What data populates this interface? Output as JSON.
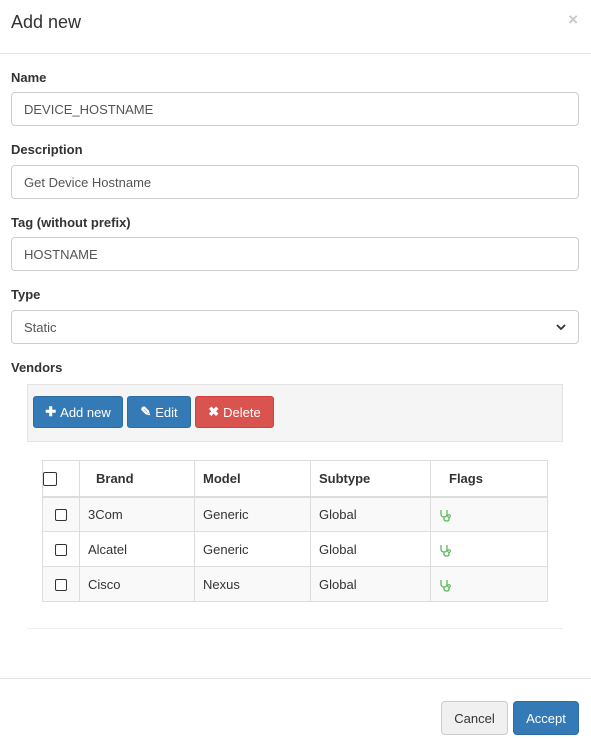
{
  "modal": {
    "title": "Add new",
    "close_glyph": "×"
  },
  "form": {
    "name_label": "Name",
    "name_value": "DEVICE_HOSTNAME",
    "description_label": "Description",
    "description_value": "Get Device Hostname",
    "tag_label": "Tag (without prefix)",
    "tag_value": "HOSTNAME",
    "type_label": "Type",
    "type_selected": "Static",
    "vendors_label": "Vendors"
  },
  "toolbar": {
    "add_label": "Add new",
    "add_icon": "plus-icon",
    "edit_label": "Edit",
    "edit_icon": "pencil-icon",
    "delete_label": "Delete",
    "delete_icon": "x-icon"
  },
  "table": {
    "columns": [
      "Brand",
      "Model",
      "Subtype",
      "Flags"
    ],
    "rows": [
      {
        "brand": "3Com",
        "model": "Generic",
        "subtype": "Global",
        "flag_icon": "stethoscope-icon"
      },
      {
        "brand": "Alcatel",
        "model": "Generic",
        "subtype": "Global",
        "flag_icon": "stethoscope-icon"
      },
      {
        "brand": "Cisco",
        "model": "Nexus",
        "subtype": "Global",
        "flag_icon": "stethoscope-icon"
      }
    ]
  },
  "footer": {
    "cancel_label": "Cancel",
    "accept_label": "Accept"
  },
  "colors": {
    "primary": "#337ab7",
    "danger": "#d9534f",
    "flag_green": "#5cb85c"
  }
}
